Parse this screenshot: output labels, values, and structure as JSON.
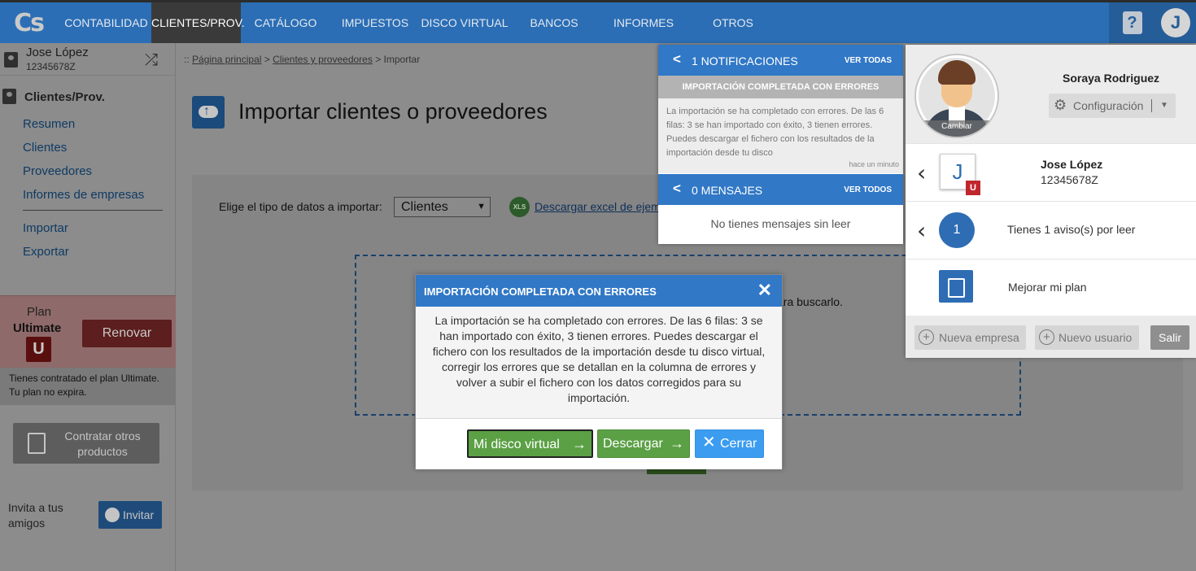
{
  "app": {
    "logo": "Cs",
    "nav": [
      "CONTABILIDAD",
      "CLIENTES/PROV.",
      "CATÁLOGO",
      "IMPUESTOS",
      "DISCO VIRTUAL",
      "BANCOS",
      "INFORMES",
      "OTROS"
    ],
    "help_icon": "?",
    "avatar_letter": "J"
  },
  "sidebar": {
    "user_name": "Jose López",
    "user_nif": "12345678Z",
    "section_title": "Clientes/Prov.",
    "links": [
      "Resumen",
      "Clientes",
      "Proveedores",
      "Informes de empresas",
      "Importar",
      "Exportar"
    ],
    "plan_label": "Plan",
    "plan_name": "Ultimate",
    "plan_badge": "U",
    "renew_label": "Renovar",
    "plan_info": "Tienes contratado el plan Ultimate. Tu plan no expira.",
    "contract_label": "Contratar otros productos",
    "invite_label": "Invita a tus amigos",
    "invite_button": "Invitar"
  },
  "main": {
    "breadcrumb_prefix": "::",
    "breadcrumb": [
      "Página principal",
      "Clientes y proveedores",
      "Importar"
    ],
    "breadcrumb_sep": ">",
    "title": "Importar clientes o proveedores",
    "type_label": "Elige el tipo de datos a importar:",
    "type_value": "Clientes",
    "xls_icon": "XLS",
    "xls_link": "Descargar excel de ejem",
    "drop_text": "ara buscarlo."
  },
  "notifications": {
    "header": "1 NOTIFICACIONES",
    "see_all": "VER TODAS",
    "item_title": "IMPORTACIÓN COMPLETADA CON ERRORES",
    "item_body": "La importación se ha completado con errores. De las 6 filas: 3 se han importado con éxito, 3 tienen errores. Puedes descargar el fichero con los resultados de la importación desde tu disco",
    "item_time": "hace un minuto",
    "messages_header": "0 MENSAJES",
    "messages_see_all": "VER TODOS",
    "messages_empty": "No tienes mensajes sin leer"
  },
  "user_panel": {
    "photo_caption": "Cambiar",
    "name": "Soraya Rodriguez",
    "config_label": "Configuración",
    "company_initial": "J",
    "company_badge": "U",
    "company_name": "Jose López",
    "company_nif": "12345678Z",
    "alerts_count": "1",
    "alerts_text": "Tienes 1 aviso(s) por leer",
    "upgrade_text": "Mejorar mi plan",
    "new_company": "Nueva empresa",
    "new_user": "Nuevo usuario",
    "logout": "Salir"
  },
  "modal": {
    "title": "IMPORTACIÓN COMPLETADA CON ERRORES",
    "body": "La importación se ha completado con errores. De las 6 filas: 3 se han importado con éxito, 3 tienen errores. Puedes descargar el fichero con los resultados de la importación desde tu disco virtual, corregir los errores que se detallan en la columna de errores y volver a subir el fichero con los datos corregidos para su importación.",
    "btn_disco": "Mi disco virtual",
    "btn_descargar": "Descargar",
    "btn_cerrar": "Cerrar"
  },
  "colors": {
    "brand_blue": "#2b6eb5",
    "header_blue": "#3178c6",
    "green": "#5ba045",
    "red": "#c0262d"
  }
}
